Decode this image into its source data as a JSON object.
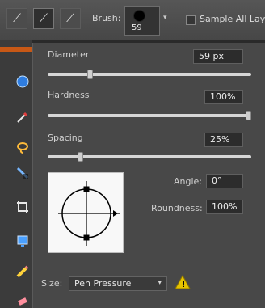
{
  "brush": {
    "label": "Brush:",
    "size": "59",
    "dropdown_icon": "caret-down-icon"
  },
  "sample_all_layers": {
    "label": "Sample All Lay",
    "checked": false
  },
  "panel": {
    "diameter": {
      "label": "Diameter",
      "value": "59 px",
      "level": 0.2
    },
    "hardness": {
      "label": "Hardness",
      "value": "100%",
      "level": 1.0
    },
    "spacing": {
      "label": "Spacing",
      "value": "25%",
      "level": 0.15
    },
    "angle": {
      "label": "Angle:",
      "value": "0°"
    },
    "roundness": {
      "label": "Roundness:",
      "value": "100%"
    },
    "size_control": {
      "label": "Size:",
      "value": "Pen Pressure"
    }
  },
  "colors": {
    "accent": "#c75816",
    "warning": "#e6c300",
    "panel_bg": "#484848"
  }
}
